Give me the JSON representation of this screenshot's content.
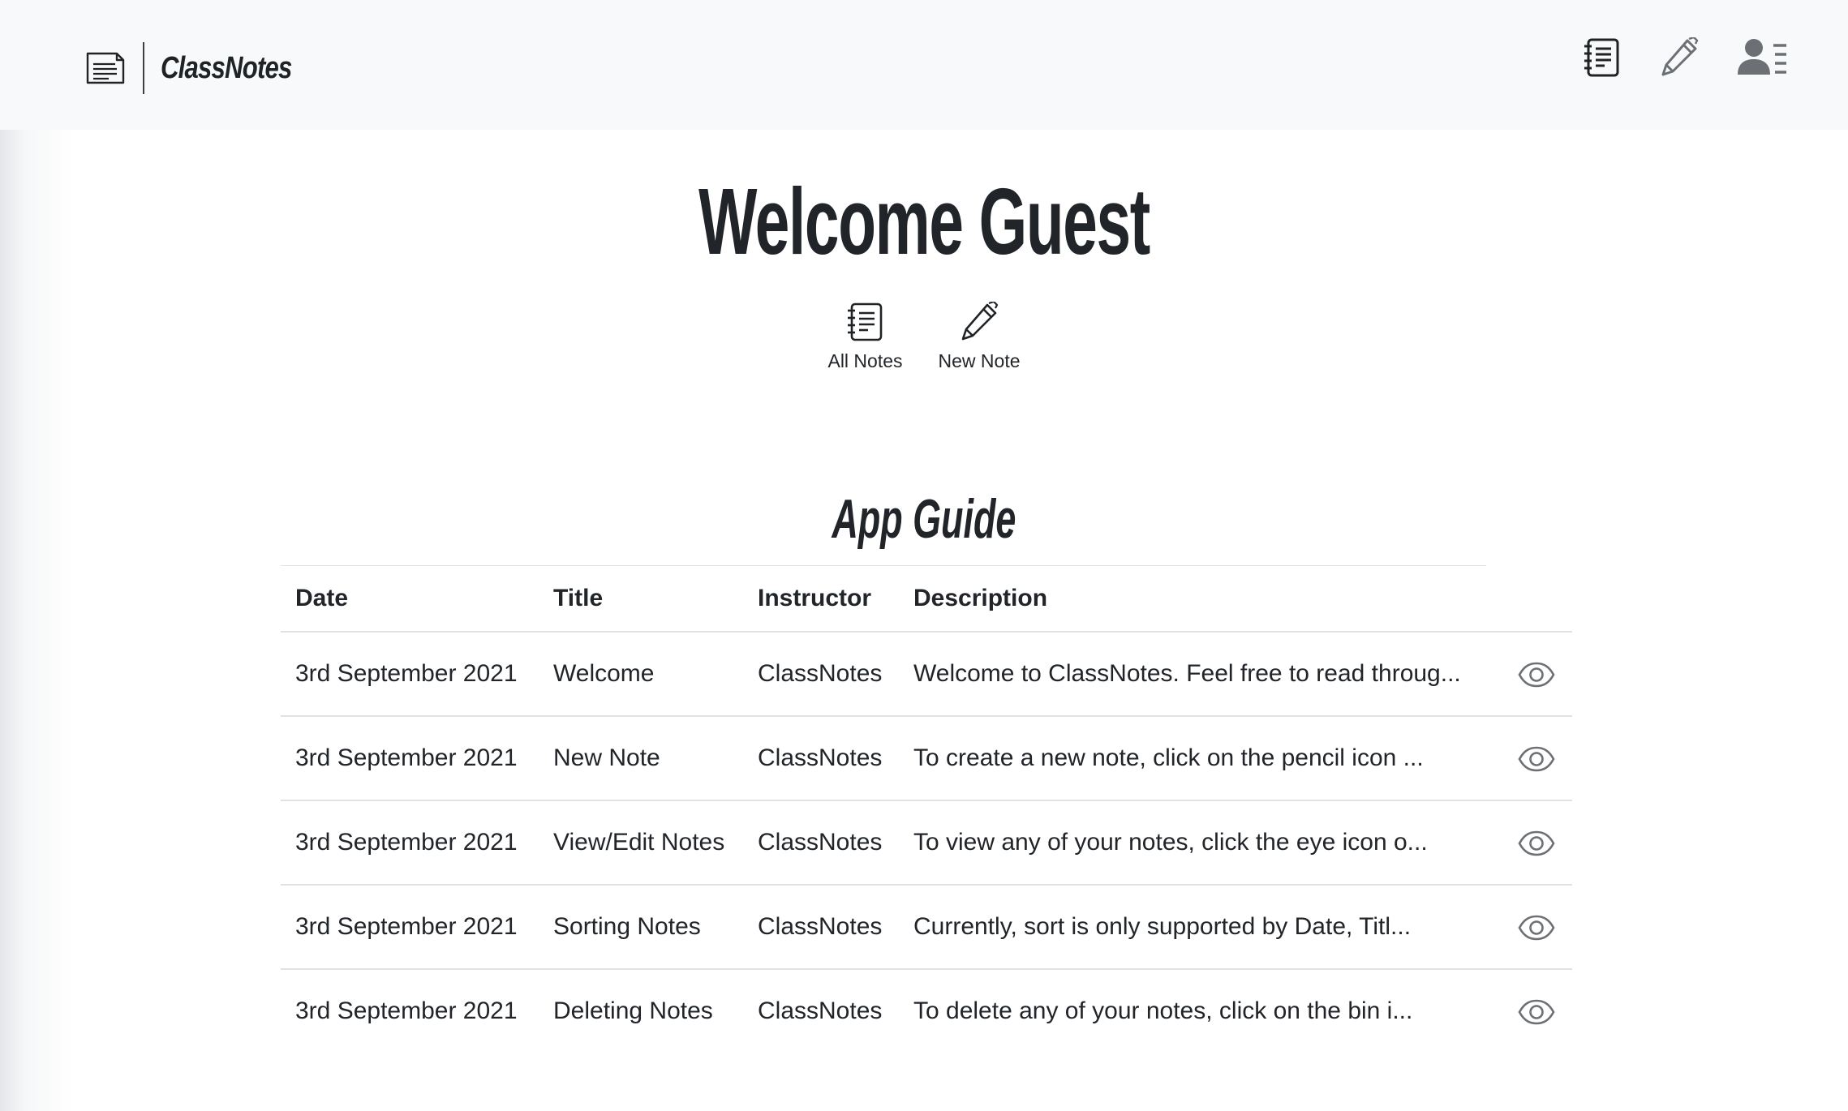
{
  "brand": {
    "name": "ClassNotes",
    "icon": "notepad-icon"
  },
  "nav": {
    "icons": [
      "notes-list-icon",
      "pencil-icon",
      "user-profile-icon"
    ]
  },
  "welcome": {
    "title": "Welcome Guest"
  },
  "quick_actions": [
    {
      "label": "All Notes",
      "icon": "notes-list-icon"
    },
    {
      "label": "New Note",
      "icon": "pencil-icon"
    }
  ],
  "guide": {
    "heading": "App Guide",
    "columns": [
      "Date",
      "Title",
      "Instructor",
      "Description"
    ],
    "rows": [
      {
        "date": "3rd September 2021",
        "title": "Welcome",
        "instructor": "ClassNotes",
        "description": "Welcome to ClassNotes. Feel free to read throug...",
        "action_icon": "eye-icon"
      },
      {
        "date": "3rd September 2021",
        "title": "New Note",
        "instructor": "ClassNotes",
        "description": "To create a new note, click on the pencil icon ...",
        "action_icon": "eye-icon"
      },
      {
        "date": "3rd September 2021",
        "title": "View/Edit Notes",
        "instructor": "ClassNotes",
        "description": "To view any of your notes, click the eye icon o...",
        "action_icon": "eye-icon"
      },
      {
        "date": "3rd September 2021",
        "title": "Sorting Notes",
        "instructor": "ClassNotes",
        "description": "Currently, sort is only supported by Date, Titl...",
        "action_icon": "eye-icon"
      },
      {
        "date": "3rd September 2021",
        "title": "Deleting Notes",
        "instructor": "ClassNotes",
        "description": "To delete any of your notes, click on the bin i...",
        "action_icon": "eye-icon"
      }
    ]
  },
  "colors": {
    "header_bg": "#f8f9fa",
    "text": "#212529",
    "icon_dark": "#1f2326",
    "icon_grey": "#6c6f73",
    "table_border": "#dee2e6"
  }
}
